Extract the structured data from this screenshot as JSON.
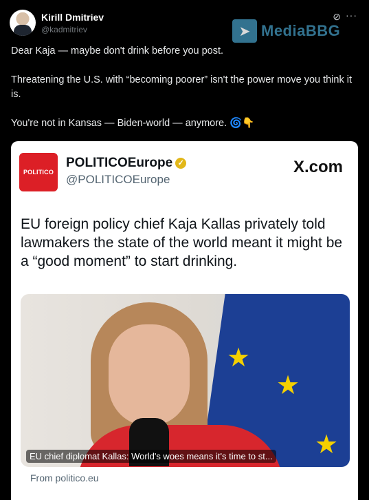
{
  "tweet": {
    "author_name": "Kirill Dmitriev",
    "author_handle": "@kadmitriev",
    "paragraphs": [
      "Dear Kaja — maybe don't drink before you post.",
      "Threatening the U.S. with “becoming poorer” isn't the power move you think it is.",
      "You're not in Kansas — Biden-world — anymore."
    ],
    "emoji_1": "🌀",
    "emoji_2": "👇"
  },
  "watermark": {
    "text": "MediaBBG"
  },
  "quoted": {
    "logo_text": "POLITICO",
    "name": "POLITICOEurope",
    "handle": "@POLITICOEurope",
    "site_badge": "X.com",
    "headline": "EU foreign policy chief Kaja Kallas privately told lawmakers the state of the world meant it might be a “good moment” to start drinking.",
    "image_caption": "EU chief diplomat Kallas: World's woes means it's time to st...",
    "source": "From politico.eu"
  },
  "icons": [
    "grok-icon",
    "more-icon",
    "verified-icon"
  ],
  "colors": {
    "politico_red": "#dc1f26",
    "verified_gold": "#e2b719",
    "watermark_blue": "#3b86a8"
  }
}
